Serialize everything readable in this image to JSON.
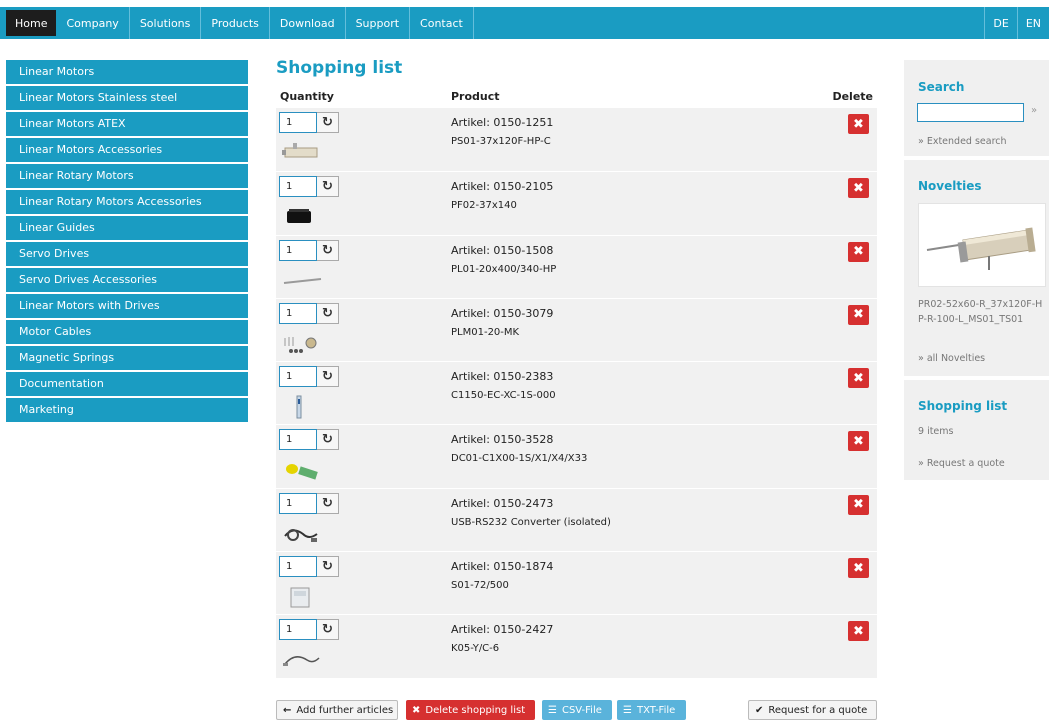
{
  "topnav": {
    "items": [
      "Home",
      "Company",
      "Solutions",
      "Products",
      "Download",
      "Support",
      "Contact"
    ],
    "languages": [
      "DE",
      "EN"
    ]
  },
  "sidebar": {
    "items": [
      "Linear Motors",
      "Linear Motors Stainless steel",
      "Linear Motors ATEX",
      "Linear Motors Accessories",
      "Linear Rotary Motors",
      "Linear Rotary Motors Accessories",
      "Linear Guides",
      "Servo Drives",
      "Servo Drives Accessories",
      "Linear Motors with Drives",
      "Motor Cables",
      "Magnetic Springs",
      "Documentation",
      "Marketing"
    ]
  },
  "main": {
    "title": "Shopping list",
    "headers": {
      "quantity": "Quantity",
      "product": "Product",
      "delete": "Delete"
    },
    "rows": [
      {
        "qty": "1",
        "article": "Artikel: 0150-1251",
        "name": "PS01-37x120F-HP-C"
      },
      {
        "qty": "1",
        "article": "Artikel: 0150-2105",
        "name": "PF02-37x140"
      },
      {
        "qty": "1",
        "article": "Artikel: 0150-1508",
        "name": "PL01-20x400/340-HP"
      },
      {
        "qty": "1",
        "article": "Artikel: 0150-3079",
        "name": "PLM01-20-MK"
      },
      {
        "qty": "1",
        "article": "Artikel: 0150-2383",
        "name": "C1150-EC-XC-1S-000"
      },
      {
        "qty": "1",
        "article": "Artikel: 0150-3528",
        "name": "DC01-C1X00-1S/X1/X4/X33"
      },
      {
        "qty": "1",
        "article": "Artikel: 0150-2473",
        "name": "USB-RS232 Converter (isolated)"
      },
      {
        "qty": "1",
        "article": "Artikel: 0150-1874",
        "name": "S01-72/500"
      },
      {
        "qty": "1",
        "article": "Artikel: 0150-2427",
        "name": "K05-Y/C-6"
      }
    ],
    "actions": {
      "add": "Add further articles",
      "delete": "Delete shopping list",
      "csv": "CSV-File",
      "txt": "TXT-File",
      "quote": "Request for a quote"
    }
  },
  "right": {
    "search": {
      "title": "Search",
      "go": "»",
      "extended": "» Extended search"
    },
    "novelties": {
      "title": "Novelties",
      "product": "PR02-52x60-R_37x120F-HP-R-100-L_MS01_TS01",
      "link": "» all Novelties"
    },
    "shopping": {
      "title": "Shopping list",
      "count": "9 items",
      "link": "» Request a quote"
    }
  },
  "colors": {
    "brand": "#1a9cc2",
    "danger": "#d63030",
    "file_button": "#5ab3db"
  },
  "icons": {
    "refresh": "refresh-icon",
    "delete": "delete-icon",
    "arrow_left": "arrow-left-icon",
    "list": "list-icon",
    "check": "check-icon"
  }
}
